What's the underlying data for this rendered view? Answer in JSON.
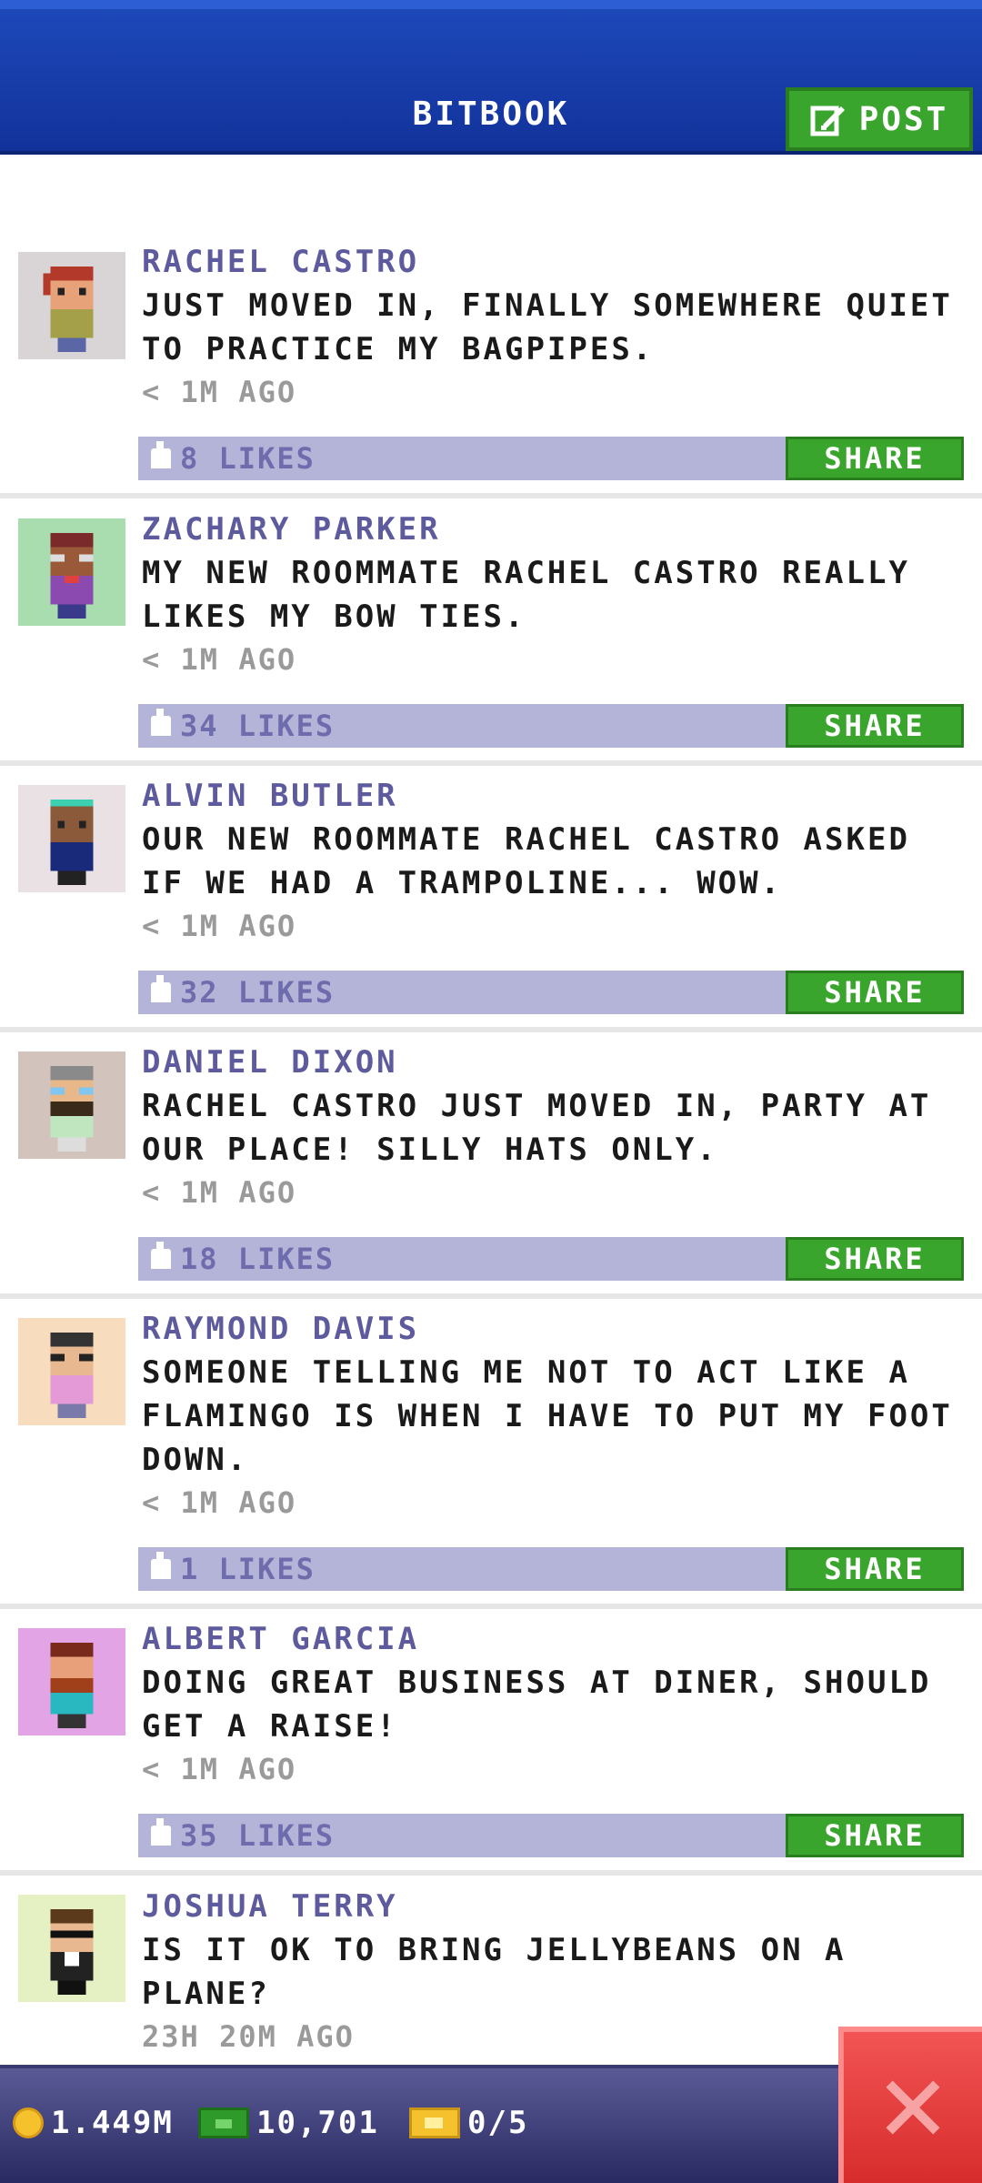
{
  "header": {
    "title": "BITBOOK",
    "post_label": "POST",
    "post_icon": "edit-icon",
    "color": "#1a43b3"
  },
  "posts": [
    {
      "author": "RACHEL CASTRO",
      "message": "JUST MOVED IN, FINALLY SOMEWHERE QUIET TO PRACTICE MY BAGPIPES.",
      "time": "< 1M AGO",
      "likes": "8 LIKES",
      "share": "SHARE",
      "avatar_bg": "#d9d4d6"
    },
    {
      "author": "ZACHARY PARKER",
      "message": "MY NEW ROOMMATE RACHEL CASTRO REALLY LIKES MY BOW TIES.",
      "time": "< 1M AGO",
      "likes": "34 LIKES",
      "share": "SHARE",
      "avatar_bg": "#a9ddb0"
    },
    {
      "author": "ALVIN BUTLER",
      "message": "OUR NEW ROOMMATE RACHEL CASTRO ASKED IF WE HAD A TRAMPOLINE... WOW.",
      "time": "< 1M AGO",
      "likes": "32 LIKES",
      "share": "SHARE",
      "avatar_bg": "#e9e1e3"
    },
    {
      "author": "DANIEL DIXON",
      "message": "RACHEL CASTRO JUST MOVED IN, PARTY AT OUR PLACE! SILLY HATS ONLY.",
      "time": "< 1M AGO",
      "likes": "18 LIKES",
      "share": "SHARE",
      "avatar_bg": "#d2c3bd"
    },
    {
      "author": "RAYMOND DAVIS",
      "message": "SOMEONE TELLING ME NOT TO ACT LIKE A FLAMINGO IS WHEN I HAVE TO PUT MY FOOT DOWN.",
      "time": "< 1M AGO",
      "likes": "1 LIKES",
      "share": "SHARE",
      "avatar_bg": "#f7dcbd"
    },
    {
      "author": "ALBERT GARCIA",
      "message": "DOING GREAT BUSINESS AT DINER, SHOULD GET A RAISE!",
      "time": "< 1M AGO",
      "likes": "35 LIKES",
      "share": "SHARE",
      "avatar_bg": "#e3a4e6"
    },
    {
      "author": "JOSHUA TERRY",
      "message": "IS IT OK TO BRING JELLYBEANS ON A PLANE?",
      "time": "23H 20M AGO",
      "avatar_bg": "#e6f1c3"
    }
  ],
  "bottom_bar": {
    "coins": "1.449M",
    "cash": "10,701",
    "tickets": "0/5"
  }
}
